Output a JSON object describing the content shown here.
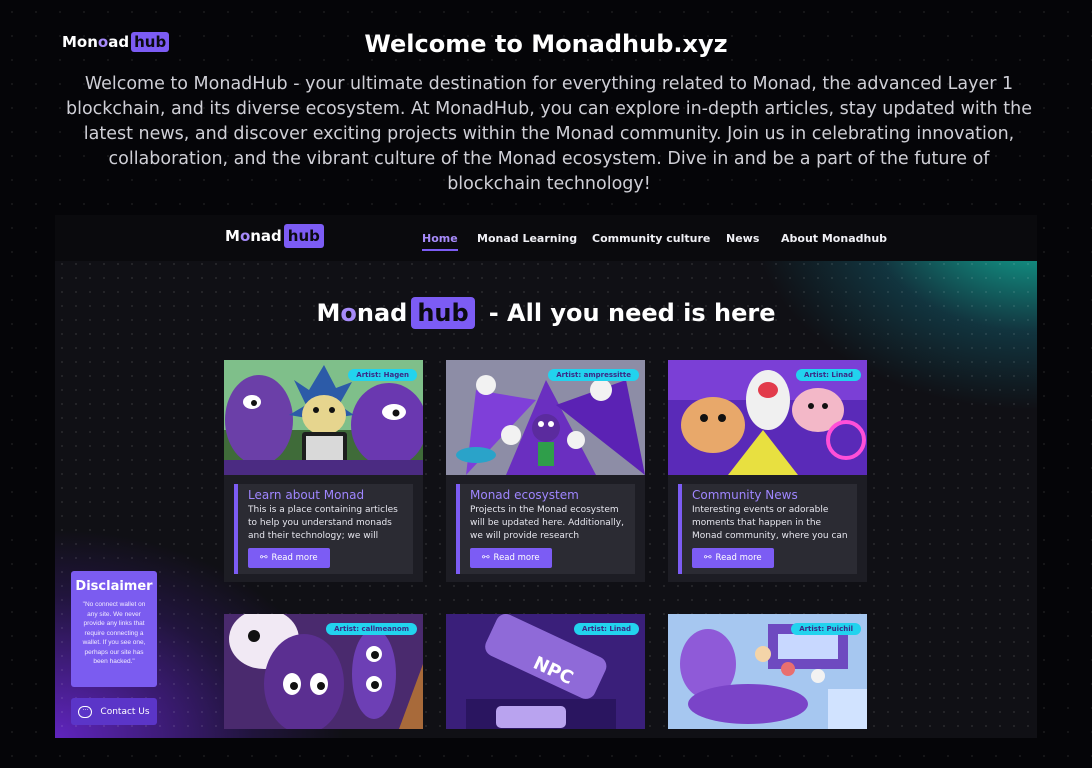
{
  "header": {
    "logo_main": "Mon",
    "logo_o": "o",
    "logo_end": "ad",
    "logo_hub": "hub",
    "title": "Welcome to Monadhub.xyz",
    "intro": "Welcome to MonadHub - your ultimate destination for everything related to Monad, the advanced Layer 1 blockchain, and its diverse ecosystem. At MonadHub, you can explore in-depth articles, stay updated with the latest news, and discover exciting projects within the Monad community. Join us in celebrating innovation, collaboration, and the vibrant culture of the Monad ecosystem. Dive in and be a part of the future of blockchain technology!"
  },
  "site": {
    "nav": {
      "logo_main": "M",
      "logo_o": "o",
      "logo_end": "nad",
      "logo_hub": "hub",
      "links": [
        "Home",
        "Monad Learning",
        "Community culture",
        "News",
        "About Monadhub"
      ]
    },
    "hero": {
      "logo_main": "M",
      "logo_o": "o",
      "logo_end": "nad",
      "logo_hub": "hub",
      "tagline": "- All you need is here"
    },
    "cards": [
      {
        "artist": "Artist: Hagen",
        "title": "Learn about Monad",
        "text": "This is a place containing articles to help you understand monads and their technology; we will update",
        "button": "Read more"
      },
      {
        "artist": "Artist: ampressitte",
        "title": "Monad ecosystem",
        "text": "Projects in the Monad ecosystem will be updated here. Additionally, we will provide research information about",
        "button": "Read more"
      },
      {
        "artist": "Artist: Linad",
        "title": "Community News",
        "text": "Interesting events or adorable moments that happen in the Monad community, where you can observe",
        "button": "Read more"
      },
      {
        "artist": "Artist: callmeanom"
      },
      {
        "artist": "Artist: Linad",
        "image_text": "NPC"
      },
      {
        "artist": "Artist: Puichil"
      }
    ],
    "disclaimer": {
      "title": "Disclaimer",
      "text": "\"No connect wallet on any site. We never provide any links that require connecting a wallet. If you see one, perhaps our site has been hacked.\""
    },
    "contact": {
      "label": "Contact Us",
      "icon": "chat-icon"
    }
  },
  "colors": {
    "accent": "#7c5cf4",
    "teal": "#22d3ee",
    "background": "#050508"
  }
}
